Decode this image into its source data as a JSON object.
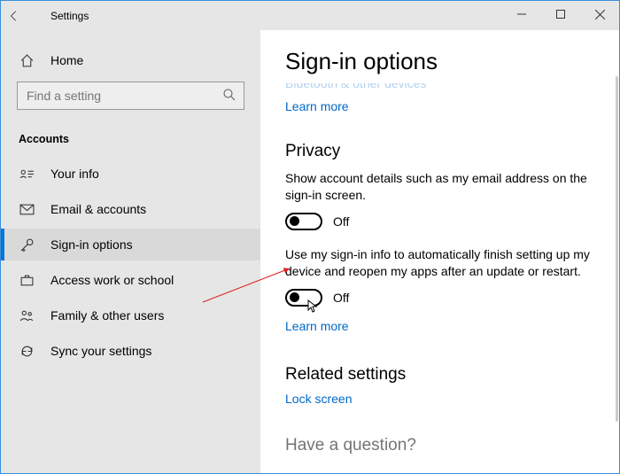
{
  "titlebar": {
    "title": "Settings"
  },
  "sidebar": {
    "home": "Home",
    "search_placeholder": "Find a setting",
    "category": "Accounts",
    "items": [
      {
        "label": "Your info"
      },
      {
        "label": "Email & accounts"
      },
      {
        "label": "Sign-in options"
      },
      {
        "label": "Access work or school"
      },
      {
        "label": "Family & other users"
      },
      {
        "label": "Sync your settings"
      }
    ]
  },
  "content": {
    "page_title": "Sign-in options",
    "peek_text": "Bluetooth & other devices",
    "learn_more_1": "Learn more",
    "privacy_head": "Privacy",
    "privacy_text": "Show account details such as my email address on the sign-in screen.",
    "toggle1_state": "Off",
    "auto_finish_text": "Use my sign-in info to automatically finish setting up my device and reopen my apps after an update or restart.",
    "toggle2_state": "Off",
    "learn_more_2": "Learn more",
    "related_head": "Related settings",
    "lock_screen": "Lock screen",
    "question_head": "Have a question?"
  }
}
